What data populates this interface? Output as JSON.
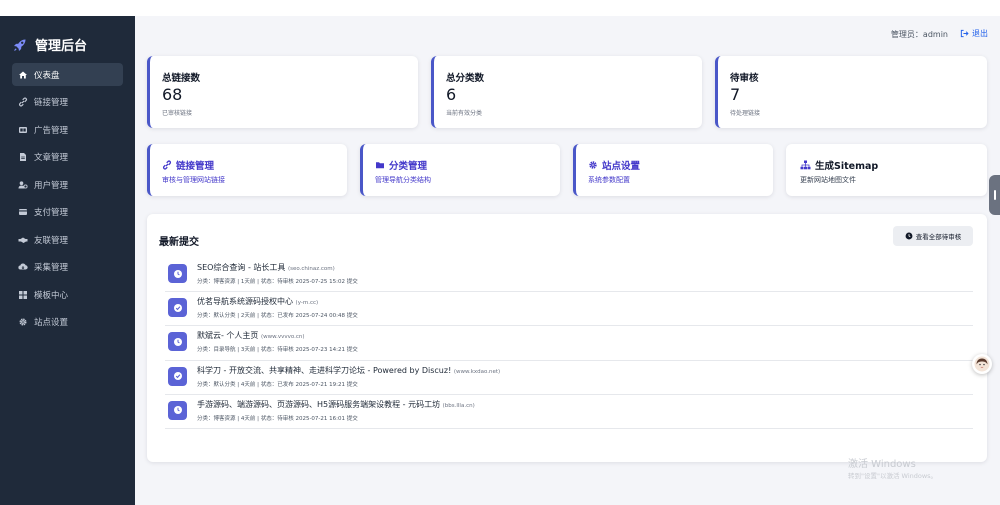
{
  "app": {
    "title": "管理后台"
  },
  "sidebar": {
    "items": [
      {
        "label": "仪表盘",
        "icon": "home-icon",
        "active": true
      },
      {
        "label": "链接管理",
        "icon": "link-icon"
      },
      {
        "label": "广告管理",
        "icon": "ad-icon"
      },
      {
        "label": "文章管理",
        "icon": "file-icon"
      },
      {
        "label": "用户管理",
        "icon": "users-icon"
      },
      {
        "label": "支付管理",
        "icon": "credit-card-icon"
      },
      {
        "label": "友联管理",
        "icon": "handshake-icon"
      },
      {
        "label": "采集管理",
        "icon": "cloud-download-icon"
      },
      {
        "label": "模板中心",
        "icon": "grid-icon"
      },
      {
        "label": "站点设置",
        "icon": "gear-icon"
      }
    ]
  },
  "header": {
    "admin": "管理员：admin",
    "logout": "退出"
  },
  "stats": [
    {
      "title": "总链接数",
      "value": "68",
      "sub": "已审核链接"
    },
    {
      "title": "总分类数",
      "value": "6",
      "sub": "当前有效分类"
    },
    {
      "title": "待审核",
      "value": "7",
      "sub": "待处理链接"
    }
  ],
  "actions": [
    {
      "title": "链接管理",
      "sub": "审核与管理网站链接",
      "icon": "link-icon"
    },
    {
      "title": "分类管理",
      "sub": "管理导航分类结构",
      "icon": "folder-icon"
    },
    {
      "title": "站点设置",
      "sub": "系统参数配置",
      "icon": "gear-icon"
    },
    {
      "title": "生成Sitemap",
      "sub": "更新网站地图文件",
      "icon": "sitemap-icon"
    }
  ],
  "recent": {
    "title": "最新提交",
    "view_all": "查看全部待审核",
    "items": [
      {
        "title": "SEO综合查询 - 站长工具",
        "domain": "(seo.chinaz.com)",
        "meta": "分类：博客资源 | 1天前 | 状态：待审核 2025-07-25 15:02 提交",
        "status": "pending"
      },
      {
        "title": "优茗导航系统源码授权中心",
        "domain": "(y-m.cc)",
        "meta": "分类：默认分类 | 2天前 | 状态：已发布 2025-07-24 00:48 提交",
        "status": "published"
      },
      {
        "title": "默斌云- 个人主页",
        "domain": "(www.vvvvo.cn)",
        "meta": "分类：目录导航 | 3天前 | 状态：待审核 2025-07-23 14:21 提交",
        "status": "pending"
      },
      {
        "title": "科学刀 - 开放交流、共享精神、走进科学刀论坛 - Powered by Discuz!",
        "domain": "(www.kxdao.net)",
        "meta": "分类：默认分类 | 4天前 | 状态：已发布 2025-07-21 19:21 提交",
        "status": "published"
      },
      {
        "title": "手游源码、端游源码、页游源码、H5源码服务端架设教程 - 元码工坊",
        "domain": "(bbs.llla.cn)",
        "meta": "分类：博客资源 | 4天前 | 状态：待审核 2025-07-21 16:01 提交",
        "status": "pending"
      }
    ]
  },
  "watermark": {
    "line1": "激活 Windows",
    "line2": "转到\"设置\"以激活 Windows。"
  },
  "colors": {
    "sidebar": "#1f2a3a",
    "accent": "#4a57c8",
    "badge": "#5b63d6",
    "link": "#2563eb"
  }
}
